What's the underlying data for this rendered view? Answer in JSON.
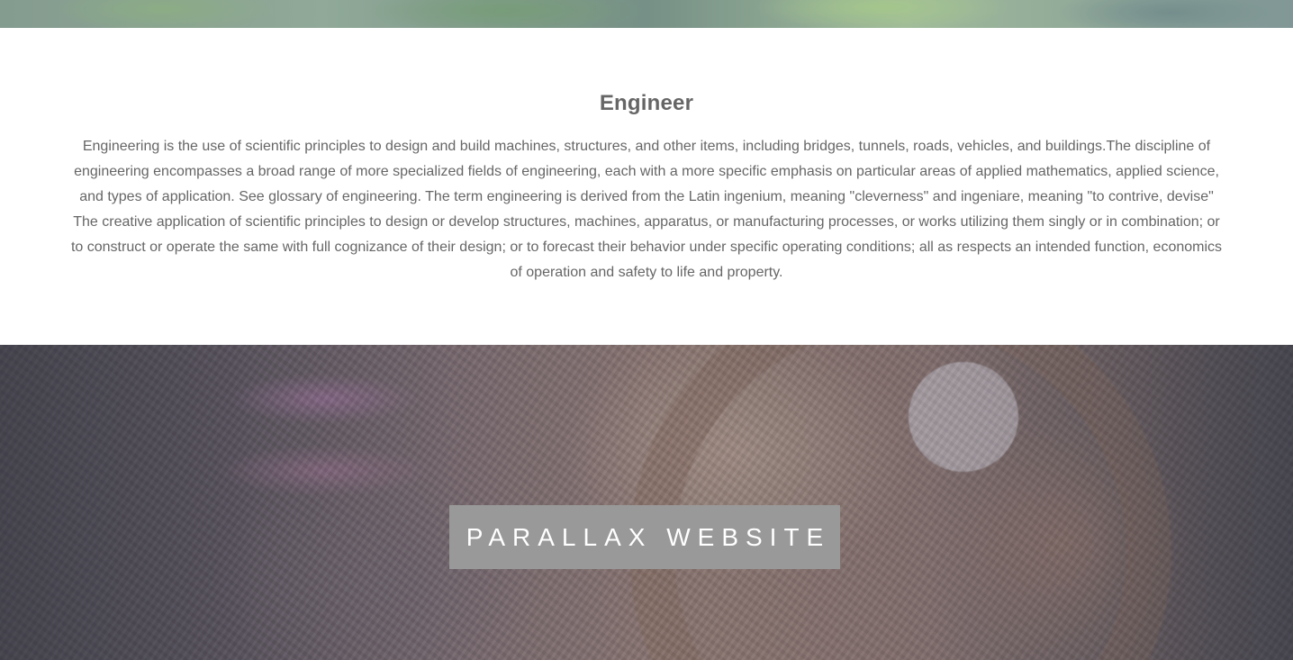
{
  "section": {
    "title": "Engineer",
    "body": "Engineering is the use of scientific principles to design and build machines, structures, and other items, including bridges, tunnels, roads, vehicles, and buildings.The discipline of engineering encompasses a broad range of more specialized fields of engineering, each with a more specific emphasis on particular areas of applied mathematics, applied science, and types of application. See glossary of engineering. The term engineering is derived from the Latin ingenium, meaning \"cleverness\" and ingeniare, meaning \"to contrive, devise\" The creative application of scientific principles to design or develop structures, machines, apparatus, or manufacturing processes, or works utilizing them singly or in combination; or to construct or operate the same with full cognizance of their design; or to forecast their behavior under specific operating conditions; all as respects an intended function, economics of operation and safety to life and property."
  },
  "hero": {
    "label": "PARALLAX WEBSITE"
  },
  "colors": {
    "text": "#666666",
    "label_bg": "#999999",
    "label_text": "#ffffff"
  }
}
